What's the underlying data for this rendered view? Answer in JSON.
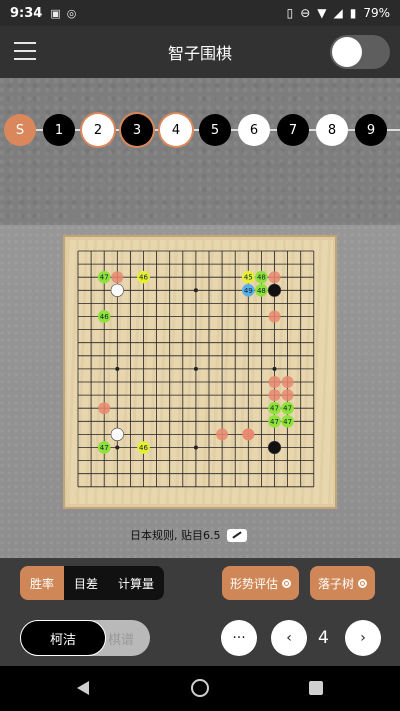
{
  "status": {
    "time": "9:34",
    "battery": "79%"
  },
  "app": {
    "title": "智子围棋"
  },
  "moves": [
    {
      "label": "S",
      "style": "orange"
    },
    {
      "label": "1",
      "style": "black"
    },
    {
      "label": "2",
      "style": "white"
    },
    {
      "label": "3",
      "style": "black"
    },
    {
      "label": "4",
      "style": "white"
    },
    {
      "label": "5",
      "style": "black"
    },
    {
      "label": "6",
      "style": "white"
    },
    {
      "label": "7",
      "style": "black"
    },
    {
      "label": "8",
      "style": "white"
    },
    {
      "label": "9",
      "style": "black"
    }
  ],
  "board": {
    "size": 19,
    "rules_text": "日本规则, 贴目6.5",
    "stones": [
      {
        "col": 15,
        "row": 3,
        "color": "black"
      },
      {
        "col": 3,
        "row": 3,
        "color": "white"
      },
      {
        "col": 15,
        "row": 15,
        "color": "black"
      },
      {
        "col": 3,
        "row": 14,
        "color": "white"
      }
    ],
    "hints": [
      {
        "col": 2,
        "row": 2,
        "label": "47",
        "color": "green"
      },
      {
        "col": 5,
        "row": 2,
        "label": "46",
        "color": "yellow"
      },
      {
        "col": 2,
        "row": 5,
        "label": "46",
        "color": "green"
      },
      {
        "col": 13,
        "row": 2,
        "label": "45",
        "color": "yellow"
      },
      {
        "col": 14,
        "row": 2,
        "label": "48",
        "color": "green"
      },
      {
        "col": 13,
        "row": 3,
        "label": "49",
        "color": "blue"
      },
      {
        "col": 14,
        "row": 3,
        "label": "48",
        "color": "green"
      },
      {
        "col": 15,
        "row": 12,
        "label": "47",
        "color": "green"
      },
      {
        "col": 16,
        "row": 12,
        "label": "47",
        "color": "green"
      },
      {
        "col": 15,
        "row": 13,
        "label": "47",
        "color": "green"
      },
      {
        "col": 16,
        "row": 13,
        "label": "47",
        "color": "green"
      },
      {
        "col": 2,
        "row": 15,
        "label": "47",
        "color": "green"
      },
      {
        "col": 5,
        "row": 15,
        "label": "46",
        "color": "yellow"
      }
    ],
    "marks": [
      {
        "col": 3,
        "row": 2
      },
      {
        "col": 15,
        "row": 2
      },
      {
        "col": 15,
        "row": 5
      },
      {
        "col": 15,
        "row": 10
      },
      {
        "col": 16,
        "row": 10
      },
      {
        "col": 15,
        "row": 11
      },
      {
        "col": 16,
        "row": 11
      },
      {
        "col": 2,
        "row": 12
      },
      {
        "col": 11,
        "row": 14
      },
      {
        "col": 13,
        "row": 14
      },
      {
        "col": 13,
        "row": 14
      }
    ]
  },
  "panel": {
    "tabs": [
      "胜率",
      "目差",
      "计算量"
    ],
    "active_tab": "胜率",
    "evaluate_label": "形势评估",
    "tree_label": "落子树",
    "ko_label": "柯洁",
    "ko_ghost": "棋谱",
    "more_label": "···",
    "prev_label": "‹",
    "next_label": "›",
    "move_number": "4"
  },
  "colors": {
    "accent": "#d08757",
    "hint_green": "#8ee23a",
    "hint_yellow": "#e6f032",
    "hint_blue": "#5ab0e6",
    "mark": "#e88870"
  }
}
